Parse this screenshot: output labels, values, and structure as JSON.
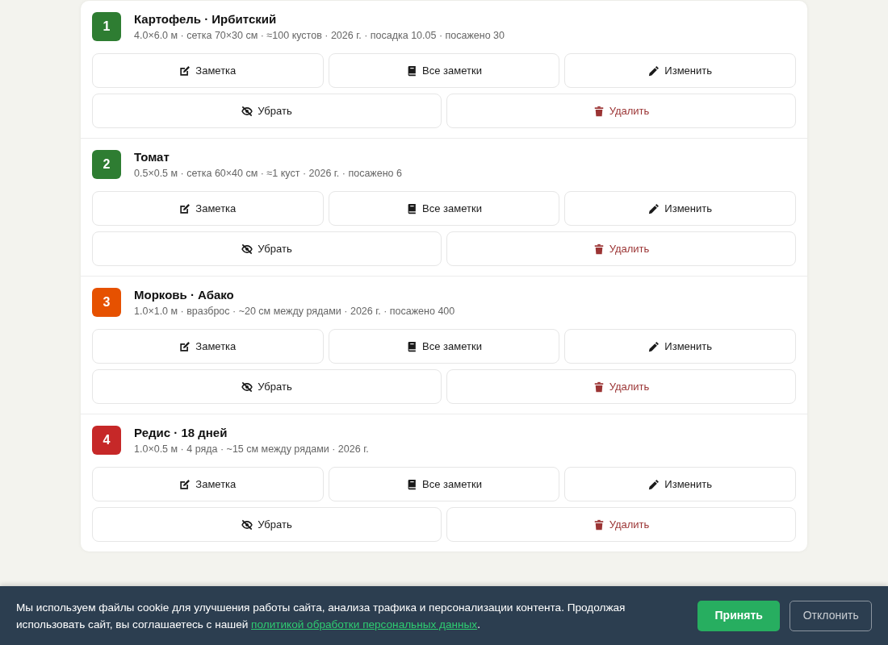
{
  "beds": [
    {
      "number": "1",
      "color": "#2e7d32",
      "title": "Картофель · Ирбитский",
      "details": "4.0×6.0 м · сетка 70×30 см · ≈100 кустов · 2026 г. · посадка 10.05 · посажено 30",
      "actions": [
        {
          "kind": "note",
          "label": "Заметка"
        },
        {
          "kind": "notes",
          "label": "Все заметки"
        },
        {
          "kind": "edit",
          "label": "Изменить"
        },
        {
          "kind": "hide",
          "label": "Убрать"
        },
        {
          "kind": "delete",
          "label": "Удалить"
        }
      ]
    },
    {
      "number": "2",
      "color": "#2e7d32",
      "title": "Томат",
      "details": "0.5×0.5 м · сетка 60×40 см · ≈1 куст · 2026 г. · посажено 6",
      "actions": [
        {
          "kind": "note",
          "label": "Заметка"
        },
        {
          "kind": "notes",
          "label": "Все заметки"
        },
        {
          "kind": "edit",
          "label": "Изменить"
        },
        {
          "kind": "hide",
          "label": "Убрать"
        },
        {
          "kind": "delete",
          "label": "Удалить"
        }
      ]
    },
    {
      "number": "3",
      "color": "#e65100",
      "title": "Морковь · Абако",
      "details": "1.0×1.0 м · вразброс · ~20 см между рядами · 2026 г. · посажено 400",
      "actions": [
        {
          "kind": "note",
          "label": "Заметка"
        },
        {
          "kind": "notes",
          "label": "Все заметки"
        },
        {
          "kind": "edit",
          "label": "Изменить"
        },
        {
          "kind": "hide",
          "label": "Убрать"
        },
        {
          "kind": "delete",
          "label": "Удалить"
        }
      ]
    },
    {
      "number": "4",
      "color": "#c62828",
      "title": "Редис · 18 дней",
      "details": "1.0×0.5 м · 4 ряда · ~15 см между рядами · 2026 г.",
      "actions": [
        {
          "kind": "note",
          "label": "Заметка"
        },
        {
          "kind": "notes",
          "label": "Все заметки"
        },
        {
          "kind": "edit",
          "label": "Изменить"
        },
        {
          "kind": "hide",
          "label": "Убрать"
        },
        {
          "kind": "delete",
          "label": "Удалить"
        }
      ]
    }
  ],
  "cookie_banner": {
    "text": "Мы используем файлы cookie для улучшения работы сайта, анализа трафика и персонализации контента. Продолжая использовать сайт, вы соглашаетесь с нашей ",
    "link": "политикой обработки персональных данных",
    "text_after": ".",
    "accept": "Принять",
    "decline": "Отклонить"
  }
}
